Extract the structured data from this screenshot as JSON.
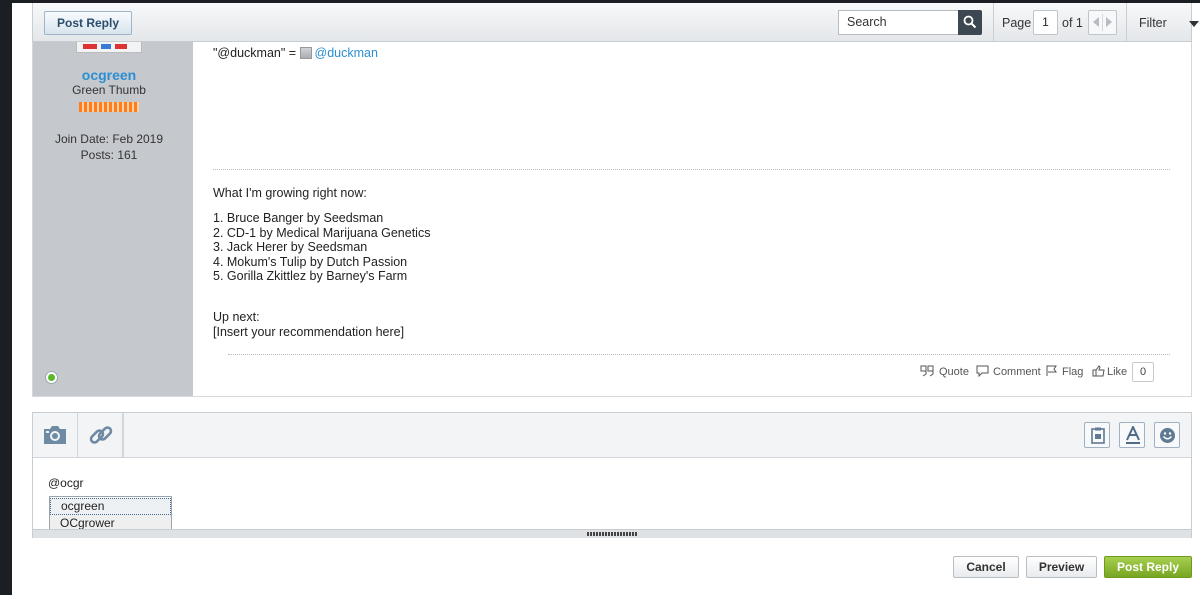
{
  "toolbar": {
    "post_reply_label": "Post Reply",
    "search_placeholder": "Search",
    "page_label": "Page",
    "page_current": "1",
    "page_of": "of 1",
    "filter_label": "Filter"
  },
  "post": {
    "user": {
      "name": "ocgreen",
      "title": "Green Thumb",
      "join_date": "Join Date: Feb 2019",
      "posts": "Posts: 161"
    },
    "mention_text": "\"@duckman\" = ",
    "mention_link": "@duckman",
    "signature": {
      "title": "What I'm growing right now:",
      "items": [
        "1. Bruce Banger by Seedsman",
        "2. CD-1 by Medical Marijuana Genetics",
        "3. Jack Herer by Seedsman",
        "4. Mokum's Tulip by Dutch Passion",
        "5. Gorilla Zkittlez by Barney's Farm"
      ],
      "up_next_label": "Up next:",
      "up_next_value": "[Insert your recommendation here]"
    },
    "actions": {
      "quote": "Quote",
      "comment": "Comment",
      "flag": "Flag",
      "like": "Like",
      "like_count": "0"
    }
  },
  "editor": {
    "text": "@ocgr",
    "autocomplete": [
      "ocgreen",
      "OCgrower"
    ]
  },
  "buttons": {
    "cancel": "Cancel",
    "preview": "Preview",
    "post_reply": "Post Reply"
  },
  "colors": {
    "link": "#2d8ed1",
    "primary_button": "#8bbb35",
    "online": "#5cb82a"
  }
}
